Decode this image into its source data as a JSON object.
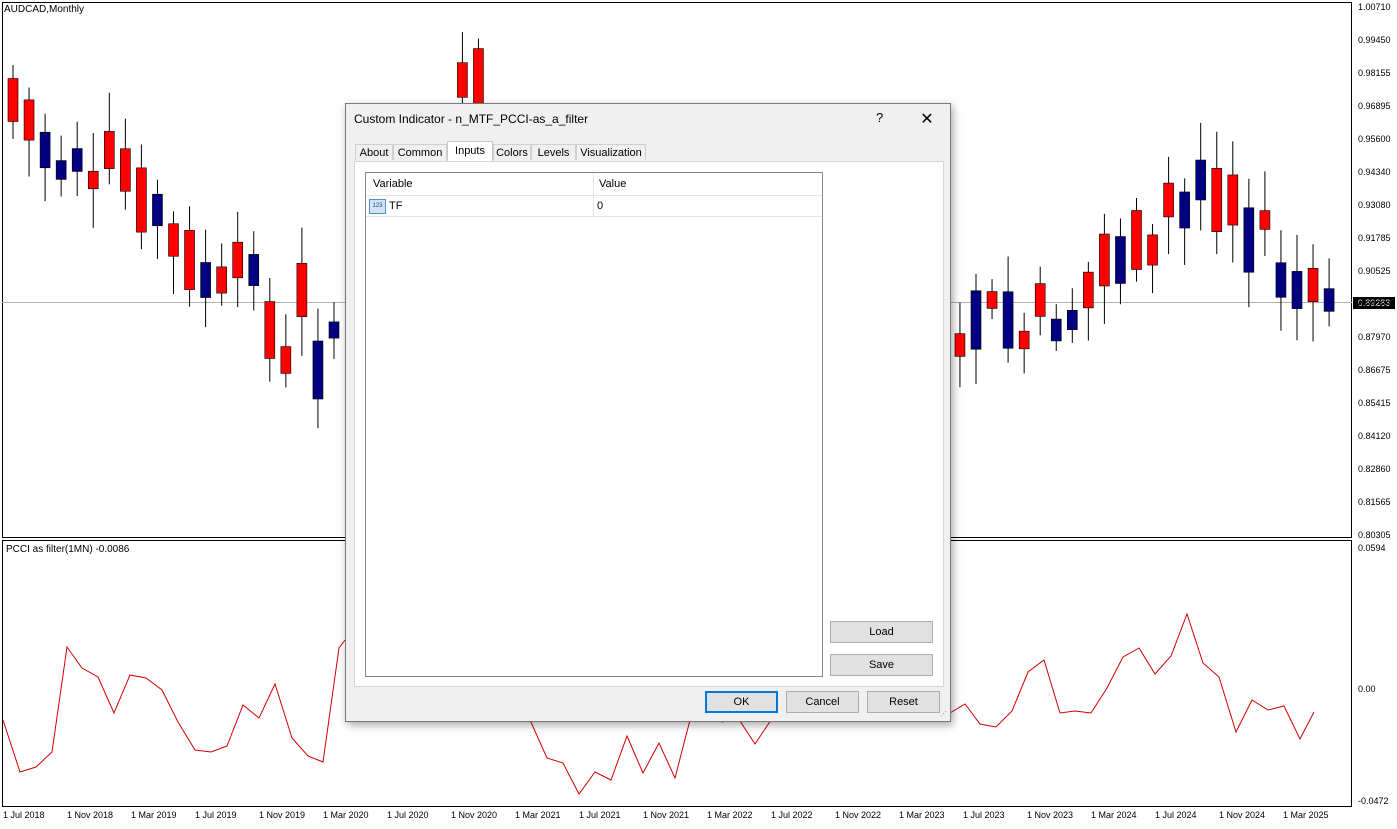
{
  "chart": {
    "symbol_label": "AUDCAD,Monthly",
    "current_price": "0.89283",
    "price_axis": [
      "1.00710",
      "0.99450",
      "0.98155",
      "0.96895",
      "0.95600",
      "0.94340",
      "0.93080",
      "0.91785",
      "0.90525",
      "0.89283",
      "0.87970",
      "0.86675",
      "0.85415",
      "0.84120",
      "0.82860",
      "0.81565",
      "0.80305"
    ],
    "date_axis": [
      "1 Jul 2018",
      "1 Nov 2018",
      "1 Mar 2019",
      "1 Jul 2019",
      "1 Nov 2019",
      "1 Mar 2020",
      "1 Jul 2020",
      "1 Nov 2020",
      "1 Mar 2021",
      "1 Jul 2021",
      "1 Nov 2021",
      "1 Mar 2022",
      "1 Jul 2022",
      "1 Nov 2022",
      "1 Mar 2023",
      "1 Jul 2023",
      "1 Nov 2023",
      "1 Mar 2024",
      "1 Jul 2024",
      "1 Nov 2024",
      "1 Mar 2025"
    ],
    "bull_color": "#000080",
    "bear_color": "#ff0000",
    "indicator_color": "#d00000"
  },
  "indicator": {
    "label": "PCCI as filter(1MN) -0.0086",
    "axis": [
      "0.0594",
      "0.00",
      "-0.0472"
    ]
  },
  "dialog": {
    "title": "Custom Indicator - n_MTF_PCCI-as_a_filter",
    "help_label": "?",
    "close_label": "✕",
    "tabs": [
      "About",
      "Common",
      "Inputs",
      "Colors",
      "Levels",
      "Visualization"
    ],
    "active_tab": "Inputs",
    "columns": {
      "variable": "Variable",
      "value": "Value"
    },
    "rows": [
      {
        "icon": "123",
        "variable": "TF",
        "value": "0"
      }
    ],
    "load_label": "Load",
    "save_label": "Save",
    "ok_label": "OK",
    "cancel_label": "Cancel",
    "reset_label": "Reset"
  }
}
